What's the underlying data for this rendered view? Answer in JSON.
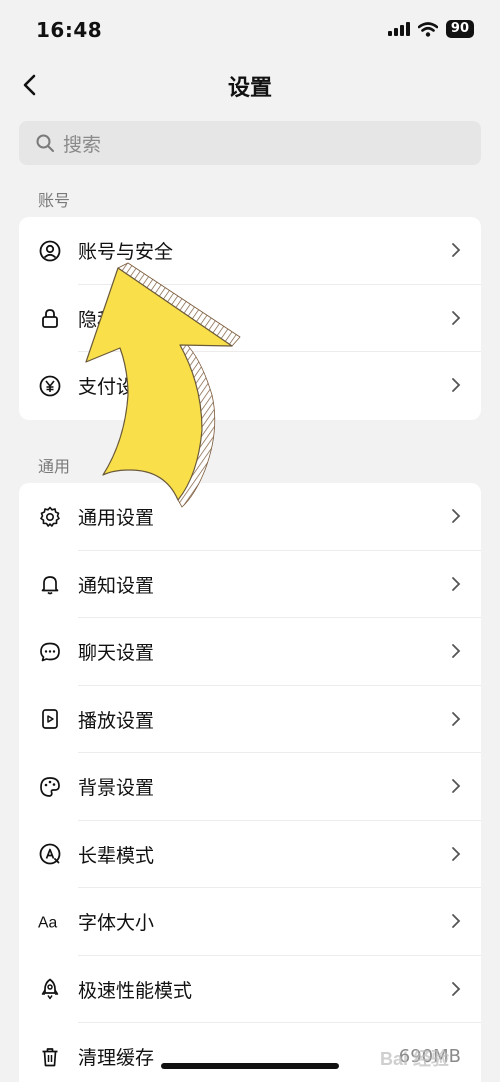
{
  "status_bar": {
    "time": "16:48",
    "battery": "90"
  },
  "header": {
    "title": "设置"
  },
  "search": {
    "placeholder": "搜索"
  },
  "sections": [
    {
      "label": "账号",
      "items": [
        {
          "label": "账号与安全",
          "icon": "user-circle-icon"
        },
        {
          "label": "隐私设置",
          "icon": "lock-icon"
        },
        {
          "label": "支付设置",
          "icon": "yuan-icon"
        }
      ]
    },
    {
      "label": "通用",
      "items": [
        {
          "label": "通用设置",
          "icon": "gear-icon"
        },
        {
          "label": "通知设置",
          "icon": "bell-icon"
        },
        {
          "label": "聊天设置",
          "icon": "chat-bubble-icon"
        },
        {
          "label": "播放设置",
          "icon": "play-icon"
        },
        {
          "label": "背景设置",
          "icon": "palette-icon"
        },
        {
          "label": "长辈模式",
          "icon": "elder-mode-icon"
        },
        {
          "label": "字体大小",
          "icon": "font-size-icon"
        },
        {
          "label": "极速性能模式",
          "icon": "rocket-icon"
        },
        {
          "label": "清理缓存",
          "icon": "trash-icon",
          "value": "690MB"
        }
      ]
    }
  ],
  "watermark": {
    "text": "Bai 经验"
  }
}
